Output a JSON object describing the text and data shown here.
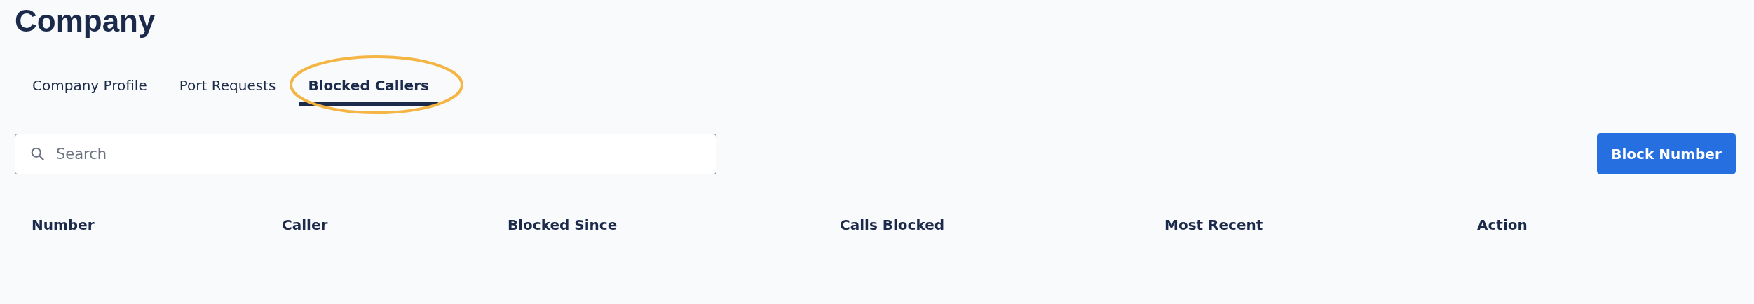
{
  "page": {
    "title": "Company"
  },
  "tabs": [
    {
      "label": "Company Profile",
      "selected": false
    },
    {
      "label": "Port Requests",
      "selected": false
    },
    {
      "label": "Blocked Callers",
      "selected": true
    }
  ],
  "search": {
    "placeholder": "Search"
  },
  "block_button": "Block Number",
  "table": {
    "columns": [
      "Number",
      "Caller",
      "Blocked Since",
      "Calls Blocked",
      "Most Recent",
      "Action"
    ]
  }
}
